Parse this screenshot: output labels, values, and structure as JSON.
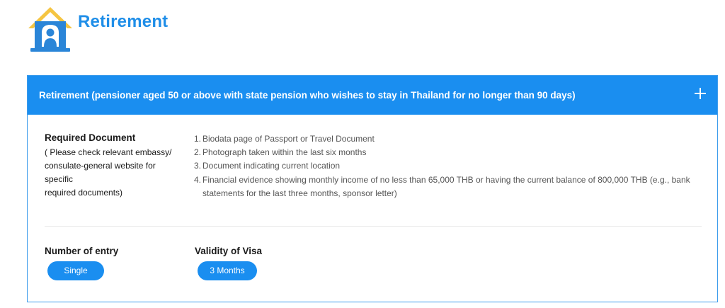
{
  "page": {
    "title": "Retirement",
    "icon": "retirement-house-person-icon"
  },
  "colors": {
    "accent": "#1a8ef0",
    "title": "#1f8ee8",
    "icon_roof": "#f5c542",
    "icon_body": "#2a85d8"
  },
  "accordion": {
    "title": "Retirement (pensioner aged 50 or above with state pension who wishes to stay in Thailand for no longer than 90 days)",
    "toggle_icon": "plus-icon",
    "required_document": {
      "heading": "Required Document",
      "note": "( Please check relevant embassy/\nconsulate-general website for\nspecific\nrequired documents)",
      "items": [
        {
          "num": "1.",
          "text": "Biodata page of Passport or Travel Document"
        },
        {
          "num": "2.",
          "text": "Photograph taken within the last six months"
        },
        {
          "num": "3.",
          "text": "Document indicating current location"
        },
        {
          "num": "4.",
          "text": "Financial evidence showing monthly income of no less than 65,000 THB or having the current balance of 800,000 THB (e.g., bank statements for the last three months, sponsor letter)"
        }
      ]
    },
    "number_of_entry": {
      "label": "Number of entry",
      "value": "Single"
    },
    "validity_of_visa": {
      "label": "Validity of Visa",
      "value": "3 Months"
    }
  }
}
